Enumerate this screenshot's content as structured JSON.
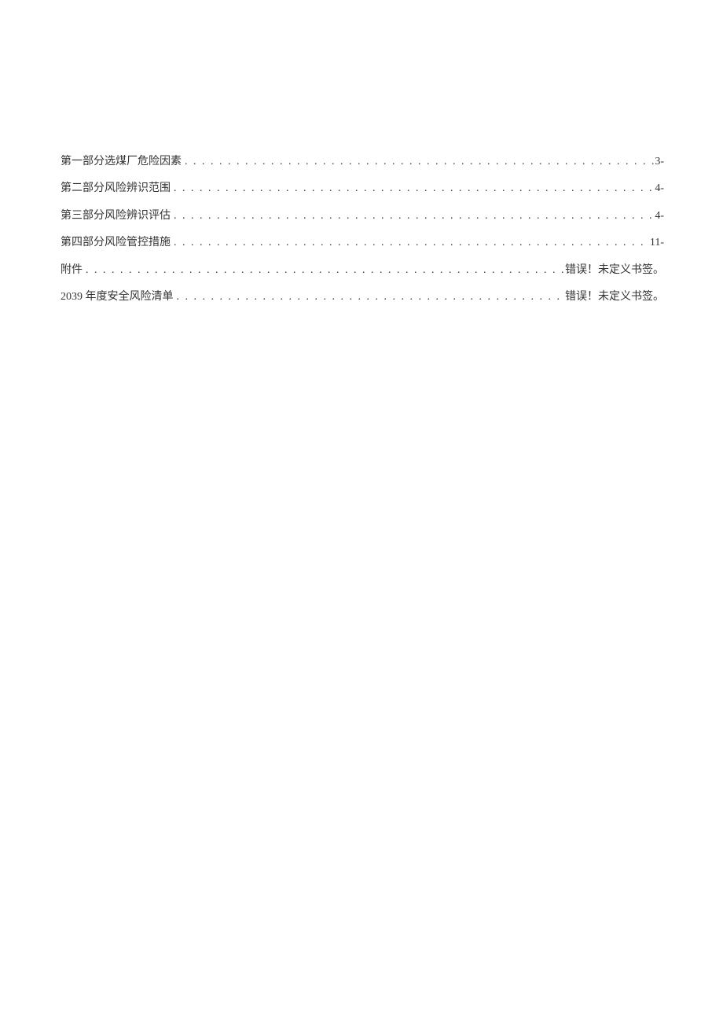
{
  "toc": {
    "entries": [
      {
        "title": "第一部分选煤厂危险因素",
        "page": "3-"
      },
      {
        "title": "第二部分风险辨识范围",
        "page": "4-"
      },
      {
        "title": "第三部分风险辨识评估",
        "page": "4-"
      },
      {
        "title": "第四部分风险管控措施",
        "page": "11-"
      },
      {
        "title": "附件",
        "page": "错误！未定义书签。"
      },
      {
        "title": "2039 年度安全风险清单",
        "page": "错误！未定义书签。"
      }
    ]
  }
}
